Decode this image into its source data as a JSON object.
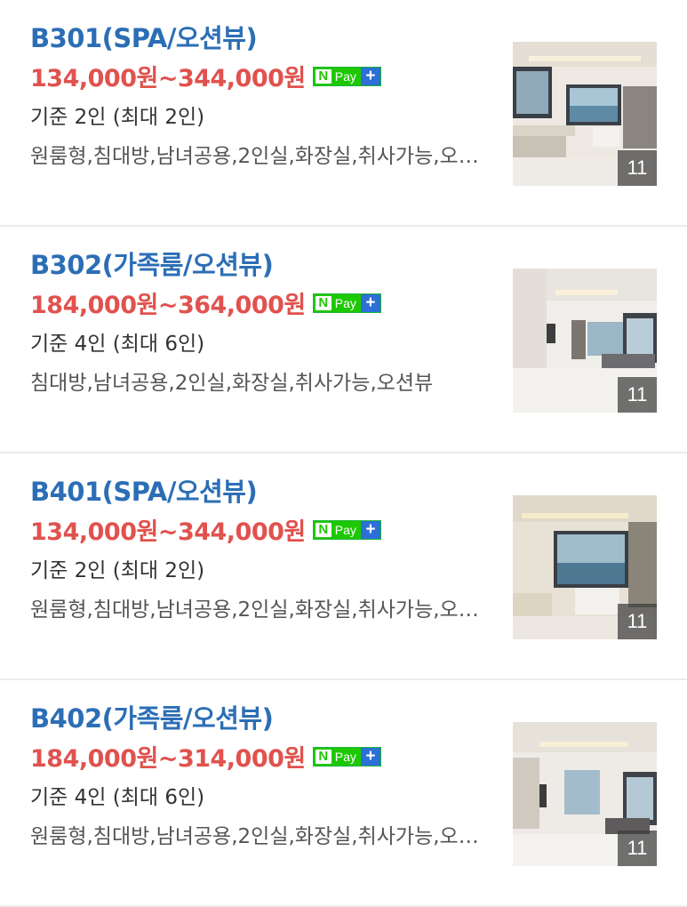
{
  "rooms": [
    {
      "name": "B301(SPA/오션뷰)",
      "price": "134,000원~344,000원",
      "capacity": "기준 2인 (최대 2인)",
      "amenities": "원룸형,침대방,남녀공용,2인실,화장실,취사가능,오션뷰,스파",
      "photo_count": "11"
    },
    {
      "name": "B302(가족룸/오션뷰)",
      "price": "184,000원~364,000원",
      "capacity": "기준 4인 (최대 6인)",
      "amenities": "침대방,남녀공용,2인실,화장실,취사가능,오션뷰",
      "photo_count": "11"
    },
    {
      "name": "B401(SPA/오션뷰)",
      "price": "134,000원~344,000원",
      "capacity": "기준 2인 (최대 2인)",
      "amenities": "원룸형,침대방,남녀공용,2인실,화장실,취사가능,오션뷰,스파",
      "photo_count": "11"
    },
    {
      "name": "B402(가족룸/오션뷰)",
      "price": "184,000원~314,000원",
      "capacity": "기준 4인 (최대 6인)",
      "amenities": "원룸형,침대방,남녀공용,2인실,화장실,취사가능,오션뷰",
      "photo_count": "11"
    }
  ],
  "npay": {
    "n": "N",
    "pay": "Pay",
    "plus": "+"
  },
  "colors": {
    "title": "#2c6eb5",
    "price": "#e0524e",
    "npay_green": "#1ec800",
    "npay_blue": "#2c6fd6"
  }
}
